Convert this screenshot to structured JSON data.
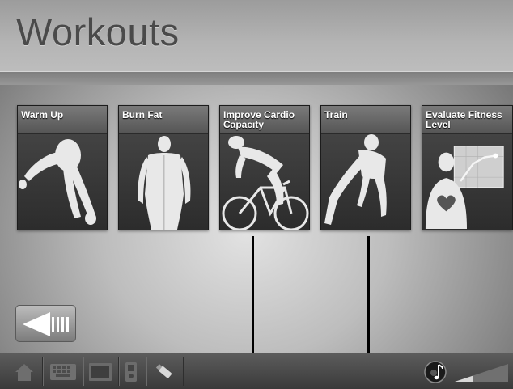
{
  "header": {
    "title": "Workouts"
  },
  "workouts": [
    {
      "id": "warm-up",
      "label": "Warm Up"
    },
    {
      "id": "burn-fat",
      "label": "Burn Fat"
    },
    {
      "id": "improve-cardio",
      "label": "Improve Cardio Capacity"
    },
    {
      "id": "train",
      "label": "Train"
    },
    {
      "id": "evaluate-fitness",
      "label": "Evaluate Fitness Level"
    }
  ],
  "navigation": {
    "back_icon": "back-arrow-icon"
  },
  "taskbar": {
    "icons": [
      "home-icon",
      "keyboard-icon",
      "display-icon",
      "media-player-icon",
      "usb-drive-icon"
    ],
    "audio_icon": "music-note-icon",
    "volume_icon": "volume-level-icon"
  }
}
